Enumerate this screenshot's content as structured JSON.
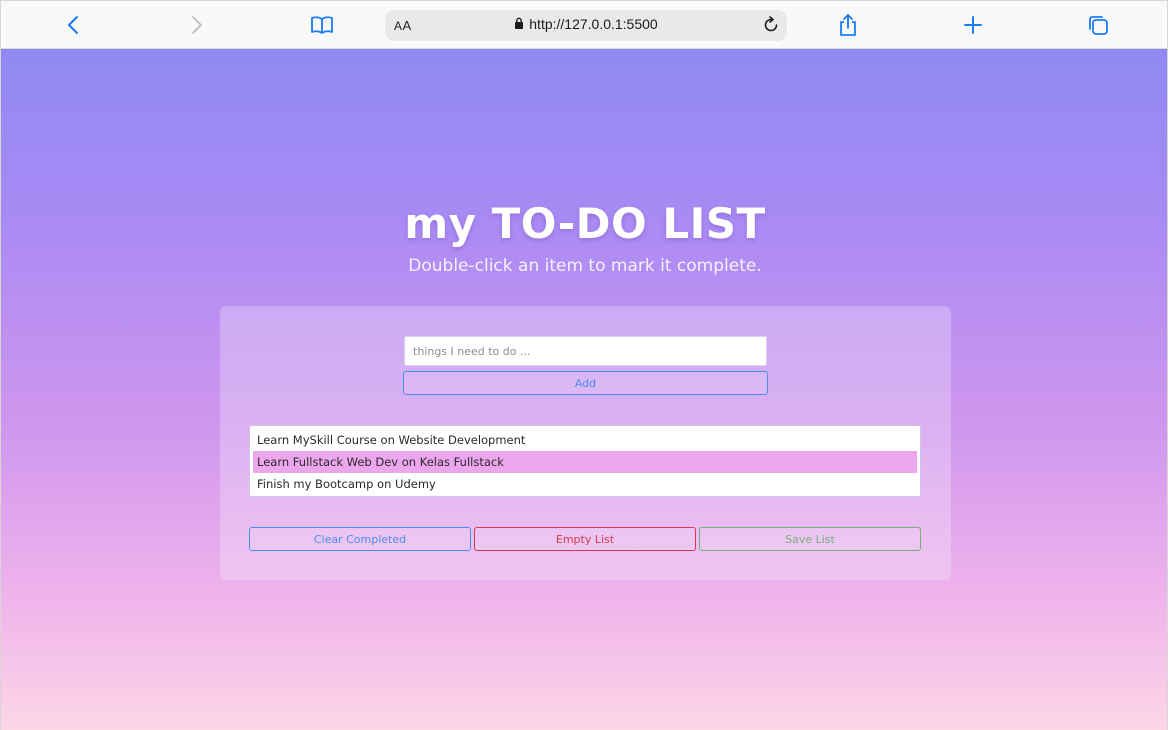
{
  "browser": {
    "address_aa_small": "A",
    "address_aa_big": "A",
    "url": "http://127.0.0.1:5500",
    "icons": [
      "back-icon",
      "forward-icon",
      "bookmarks-icon",
      "lock-icon",
      "reload-icon",
      "share-icon",
      "new-tab-icon",
      "tabs-icon"
    ],
    "accent_color": "#1a7cf5"
  },
  "page": {
    "title": "my TO-DO LIST",
    "subtitle": "Double-click an item to mark it complete.",
    "input_placeholder": "things I need to do ...",
    "input_value": "",
    "add_label": "Add",
    "items": [
      {
        "text": "Learn MySkill Course on Website Development",
        "selected": false
      },
      {
        "text": "Learn Fullstack Web Dev on Kelas Fullstack",
        "selected": true
      },
      {
        "text": "Finish my Bootcamp on Udemy",
        "selected": false
      }
    ],
    "buttons": {
      "clear_completed": "Clear Completed",
      "empty_list": "Empty List",
      "save_list": "Save List"
    },
    "colors": {
      "selected_item": "#eca6ee",
      "clear_button": "#4a8cf0",
      "empty_button": "#d8394f",
      "save_button": "#74b07a"
    }
  }
}
